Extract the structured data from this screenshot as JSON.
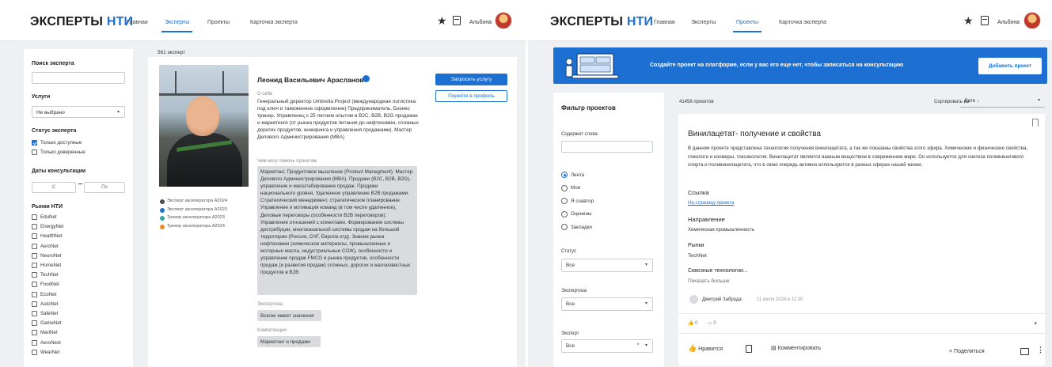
{
  "colors": {
    "accent": "#1d6fd1",
    "page_bg": "#eef0f3",
    "chip_bg": "#d9dbdf"
  },
  "left": {
    "logo": {
      "part1": "ЭКСПЕРТЫ",
      "part2": "НТИ"
    },
    "nav": [
      {
        "label": "Главная"
      },
      {
        "label": "Эксперты",
        "active": true
      },
      {
        "label": "Проекты"
      },
      {
        "label": "Карточка эксперта"
      }
    ],
    "user": {
      "name": "Альбина"
    },
    "filters": {
      "search_title": "Поиск эксперта",
      "services_title": "Услуги",
      "services_value": "Не выбрано",
      "status_title": "Статус эксперта",
      "status_options": [
        {
          "label": "Только доступные",
          "checked": true
        },
        {
          "label": "Только доверенные",
          "checked": false
        }
      ],
      "dates_title": "Даты консультации",
      "date_from": "С",
      "date_to": "По",
      "markets_title": "Рынки НТИ",
      "markets": [
        "EduNet",
        "EnergyNet",
        "HealthNet",
        "AeroNet",
        "NeuroNet",
        "HomeNet",
        "TechNet",
        "FoodNet",
        "EcoNet",
        "AutoNet",
        "SafeNet",
        "GameNet",
        "MariNet",
        "AeroNext",
        "WearNet"
      ]
    },
    "count": "561 эксперт",
    "expert": {
      "name": "Леонид Васильевич Арасланов",
      "about_label": "О себе",
      "about": "Генеральный директор Umbrella Project (международная логистика под ключ и таможенное оформление) Предприниматель. Бизнес тренер. Управленец с 25 летним опытом в B2C, B2B, B2G продажах и маркетинге (от рынка продуктов питания до нефтехимии, сложных дорогих продуктов, инжиринга и управления продажами). Мастер Делового Администрирования (MBA)",
      "help_label": "Чем могу помочь проектам",
      "help": "Маркетинг, Продуктовое мышление (Product Manegment). Мастер Делового Администрирования (MBA). Продажи (B2C, B2B, B2G), управление и масштабирование продаж. Продажи национального уровня. Удаленное управление B2B продажами. Стратегический менеджмент, стратегическое планирование. Управление и мотивация команд (в том числе удаленное). Деловые переговоры (особенности B2B переговоров). Управление отношений с клиентами. Формирование системы дистрибуции, многоканальной системы продаж на большой территории (Россия, СНГ, Европа итд). Знание рынка нефтехимии (химическое материалы, промышленные и моторные масла, индустриальные СОЖ), особенности и управление продаж FMCG и рынка продуктов, особенности продаж (и развития продаж) сложных, дорогих и малоизвестных продуктов в B2B",
      "expertise_label": "Экспертиза",
      "expertise": "Все/не имеет значения",
      "competence_label": "Компетенции",
      "competence": "Маркетинг и продажи",
      "roles": [
        {
          "label": "Эксперт акселератора А2024",
          "color": "#4a4d52"
        },
        {
          "label": "Эксперт акселератора А2023",
          "color": "#1d6fd1"
        },
        {
          "label": "Трекер акселератора А2023",
          "color": "#2ea99a"
        },
        {
          "label": "Трекер акселератора А2024",
          "color": "#f08a24"
        }
      ],
      "btn_request": "Запросить услугу",
      "btn_profile": "Перейти в профиль"
    }
  },
  "right": {
    "logo": {
      "part1": "ЭКСПЕРТЫ",
      "part2": "НТИ"
    },
    "nav": [
      {
        "label": "Главная"
      },
      {
        "label": "Эксперты"
      },
      {
        "label": "Проекты",
        "active": true
      },
      {
        "label": "Карточка эксперта"
      }
    ],
    "user": {
      "name": "Альбина"
    },
    "banner": {
      "text": "Создайте проект на платформе, если у вас его еще нет, чтобы записаться на консультацию",
      "button": "Добавить проект"
    },
    "filter": {
      "title": "Фильтр проектов",
      "words_label": "Содержит слова",
      "radios": [
        {
          "label": "Лента",
          "on": true
        },
        {
          "label": "Мои",
          "on": false
        },
        {
          "label": "Я соавтор",
          "on": false
        },
        {
          "label": "Оценены",
          "on": false
        },
        {
          "label": "Закладки",
          "on": false
        }
      ],
      "status_label": "Статус",
      "status_value": "Все",
      "expertise_label": "Экспертиза",
      "expertise_value": "Все",
      "expert_label": "Эксперт",
      "expert_value": "Все"
    },
    "count": "41458 проектов",
    "sort_label": "Сортировать по",
    "sort_value": "Дате ↓",
    "project": {
      "title": "Винилацетат- получение и свойства",
      "description": "В данном проекте представлена технология получения винилацетата, а так же показаны свойства этого эфира. Химические и физические свойства, гомологи и изомеры, токсикология. Винилацетат является важным веществом в современном мире. Он используется для синтеза поливинилового спирта и поливинилацетата, что в свою очередь активно используются в разных сферах нашей жизни.",
      "link_label": "Ссылка",
      "link_text": "На страницу проекта",
      "direction_label": "Направление",
      "direction": "Химическая промышленность",
      "markets_label": "Рынки",
      "markets": "TechNet",
      "tech_label": "Сквозные технологии...",
      "show_more": "Показать больше",
      "author": "Дмитрий Заброда",
      "date": "11 июля 2024 в 11:30",
      "likes": "0",
      "comments": "0",
      "action_like": "Нравится",
      "action_comment": "Комментировать",
      "action_share": "Поделиться"
    }
  }
}
